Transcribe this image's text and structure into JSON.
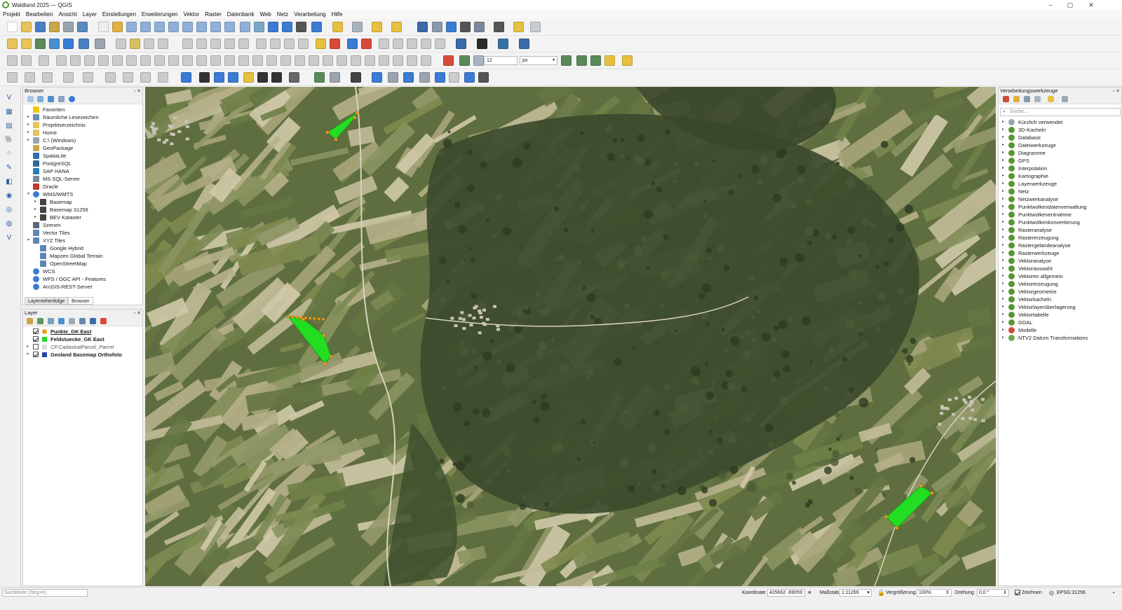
{
  "window": {
    "title": "Waldland 2025 — QGIS",
    "minimize": "–",
    "maximize": "▢",
    "close": "✕"
  },
  "menu": [
    "Projekt",
    "Bearbeiten",
    "Ansicht",
    "Layer",
    "Einstellungen",
    "Erweiterungen",
    "Vektor",
    "Raster",
    "Datenbank",
    "Web",
    "Netz",
    "Verarbeitung",
    "Hilfe"
  ],
  "snapping": {
    "tolerance": "12",
    "unit": "px"
  },
  "browser": {
    "title": "Browser",
    "items": [
      {
        "label": "Favoriten",
        "icon": "star-icon",
        "level": 0,
        "expand": ""
      },
      {
        "label": "Räumliche Lesezeichen",
        "icon": "bookmark-icon",
        "level": 0,
        "expand": "▸"
      },
      {
        "label": "Projektverzeichnis",
        "icon": "folder-icon",
        "level": 0,
        "expand": "▸"
      },
      {
        "label": "Home",
        "icon": "folder-icon",
        "level": 0,
        "expand": "▸"
      },
      {
        "label": "C:\\ (Windows)",
        "icon": "drive-icon",
        "level": 0,
        "expand": "▸"
      },
      {
        "label": "GeoPackage",
        "icon": "geopackage-icon",
        "level": 0,
        "expand": ""
      },
      {
        "label": "SpatiaLite",
        "icon": "spatialite-icon",
        "level": 0,
        "expand": ""
      },
      {
        "label": "PostgreSQL",
        "icon": "postgresql-icon",
        "level": 0,
        "expand": ""
      },
      {
        "label": "SAP HANA",
        "icon": "hana-icon",
        "level": 0,
        "expand": ""
      },
      {
        "label": "MS SQL-Server",
        "icon": "mssql-icon",
        "level": 0,
        "expand": ""
      },
      {
        "label": "Oracle",
        "icon": "oracle-icon",
        "level": 0,
        "expand": ""
      },
      {
        "label": "WMS/WMTS",
        "icon": "globe-icon",
        "level": 0,
        "expand": "▾"
      },
      {
        "label": "Basemap",
        "icon": "wms-icon",
        "level": 1,
        "expand": "▸"
      },
      {
        "label": "Basemap 31256",
        "icon": "wms-icon",
        "level": 1,
        "expand": "▸"
      },
      {
        "label": "BEV Kataster",
        "icon": "wms-icon",
        "level": 1,
        "expand": "▸"
      },
      {
        "label": "Szenen",
        "icon": "scene-icon",
        "level": 0,
        "expand": ""
      },
      {
        "label": "Vector Tiles",
        "icon": "grid-icon",
        "level": 0,
        "expand": ""
      },
      {
        "label": "XYZ Tiles",
        "icon": "grid-icon",
        "level": 0,
        "expand": "▾"
      },
      {
        "label": "Google Hybrid",
        "icon": "grid-icon",
        "level": 1,
        "expand": ""
      },
      {
        "label": "Mapzen Global Terrain",
        "icon": "grid-icon",
        "level": 1,
        "expand": ""
      },
      {
        "label": "OpenStreetMap",
        "icon": "grid-icon",
        "level": 1,
        "expand": ""
      },
      {
        "label": "WCS",
        "icon": "globe-icon",
        "level": 0,
        "expand": ""
      },
      {
        "label": "WFS / OGC API - Features",
        "icon": "globe-icon",
        "level": 0,
        "expand": ""
      },
      {
        "label": "ArcGIS-REST-Server",
        "icon": "globe-icon",
        "level": 0,
        "expand": ""
      }
    ],
    "tabs": [
      "Layerreihenfolge",
      "Browser"
    ]
  },
  "layers": {
    "title": "Layer",
    "items": [
      {
        "label": "Punkte_GK East",
        "checked": true,
        "style": "bold-underline",
        "swatch": "#e8a020",
        "expand": ""
      },
      {
        "label": "Feldstuecke_GK East",
        "checked": true,
        "style": "bold",
        "swatch": "#22dd22",
        "expand": ""
      },
      {
        "label": "CP.CadastralParcel_Parcel",
        "checked": false,
        "style": "italic",
        "swatch": "#dddddd",
        "expand": "▸"
      },
      {
        "label": "Geoland Basemap Orthofoto",
        "checked": true,
        "style": "bold",
        "swatch": "#2244aa",
        "expand": "▾"
      }
    ]
  },
  "processing": {
    "title": "Verarbeitungswerkzeuge",
    "search_placeholder": "Suche...",
    "items": [
      "Kürzlich verwendet",
      "3D-Kacheln",
      "Database",
      "Dateiwerkzeuge",
      "Diagramme",
      "GPS",
      "Interpolation",
      "Kartographie",
      "Layerwerkzeuge",
      "Netz",
      "Netzwerkanalyse",
      "Punktwolkendatenverwaltung",
      "Punktwolkenentnahme",
      "Punktwolkenkonvertierung",
      "Rasteranalyse",
      "Rastererzeugung",
      "Rastergeländeanalyse",
      "Rasterwerkzeuge",
      "Vektoranalyse",
      "Vektorauswahl",
      "Vektoren allgemein",
      "Vektorerzeugung",
      "Vektorgeometrie",
      "Vektorkacheln",
      "Vektorlayerüberlagerung",
      "Vektortabelle",
      "GDAL",
      "Modelle",
      "NTV2 Datum Transformations"
    ]
  },
  "statusbar": {
    "search_placeholder": "Suchleiste (Strg+K)",
    "coord_label": "Koordinate",
    "coord_value": "425662 -69059",
    "scale_label": "Maßstab",
    "scale_value": "1:11269",
    "mag_label": "Vergrößerung",
    "mag_value": "100%",
    "rot_label": "Drehung",
    "rot_value": "0,0 °",
    "render_label": "Zeichnen",
    "crs": "EPSG:31256"
  },
  "colors": {
    "accent": "#589632",
    "field_fill": "#22dd22",
    "point_fill": "#f0a020"
  }
}
